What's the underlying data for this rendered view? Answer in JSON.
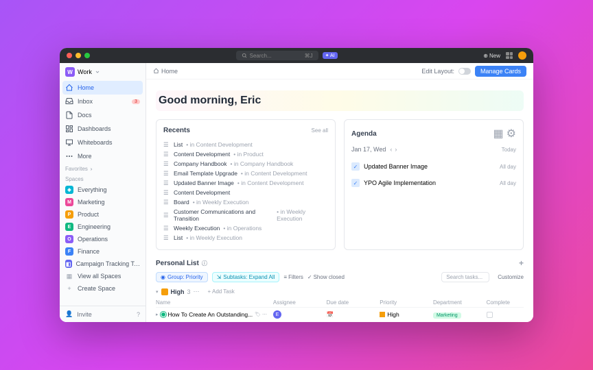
{
  "titlebar": {
    "search_placeholder": "Search...",
    "shortcut": "⌘J",
    "ai_label": "AI",
    "new_label": "New"
  },
  "workspace": {
    "initial": "W",
    "name": "Work"
  },
  "nav": {
    "home": "Home",
    "inbox": "Inbox",
    "inbox_badge": "3",
    "docs": "Docs",
    "dashboards": "Dashboards",
    "whiteboards": "Whiteboards",
    "more": "More"
  },
  "sections": {
    "favorites": "Favorites",
    "spaces": "Spaces"
  },
  "spaces": {
    "everything": "Everything",
    "marketing": "Marketing",
    "product": "Product",
    "engineering": "Engineering",
    "operations": "Operations",
    "finance": "Finance",
    "campaign": "Campaign Tracking Template",
    "view_all": "View all Spaces",
    "create": "Create Space"
  },
  "footer": {
    "invite": "Invite"
  },
  "topbar": {
    "breadcrumb": "Home",
    "edit_layout": "Edit Layout:",
    "manage": "Manage Cards"
  },
  "greeting": "Good morning, Eric",
  "recents": {
    "title": "Recents",
    "see_all": "See all",
    "items": [
      {
        "name": "List",
        "loc": "in Content Development"
      },
      {
        "name": "Content Development",
        "loc": "in Product"
      },
      {
        "name": "Company Handbook",
        "loc": "in Company Handbook"
      },
      {
        "name": "Email Template Upgrade",
        "loc": "in Content Development"
      },
      {
        "name": "Updated Banner Image",
        "loc": "in Content Development"
      },
      {
        "name": "Content Development",
        "loc": ""
      },
      {
        "name": "Board",
        "loc": "in Weekly Execution"
      },
      {
        "name": "Customer Communications and Transition",
        "loc": "in Weekly Execution"
      },
      {
        "name": "Weekly Execution",
        "loc": "in Operations"
      },
      {
        "name": "List",
        "loc": "in Weekly Execution"
      }
    ]
  },
  "agenda": {
    "title": "Agenda",
    "date": "Jan 17, Wed",
    "today": "Today",
    "items": [
      {
        "name": "Updated Banner Image",
        "time": "All day"
      },
      {
        "name": "YPO Agile Implementation",
        "time": "All day"
      }
    ]
  },
  "plist": {
    "title": "Personal List",
    "group_chip": "Group: Priority",
    "subtasks_chip": "Subtasks: Expand All",
    "filters": "Filters",
    "show_closed": "Show closed",
    "search_placeholder": "Search tasks...",
    "customize": "Customize",
    "group": {
      "name": "High",
      "count": "3"
    },
    "add_task": "+ Add Task",
    "columns": {
      "name": "Name",
      "assignee": "Assignee",
      "due": "Due date",
      "priority": "Priority",
      "dept": "Department",
      "complete": "Complete"
    },
    "task": {
      "name": "How To Create An Outstanding...",
      "priority": "High",
      "dept": "Marketing"
    }
  }
}
